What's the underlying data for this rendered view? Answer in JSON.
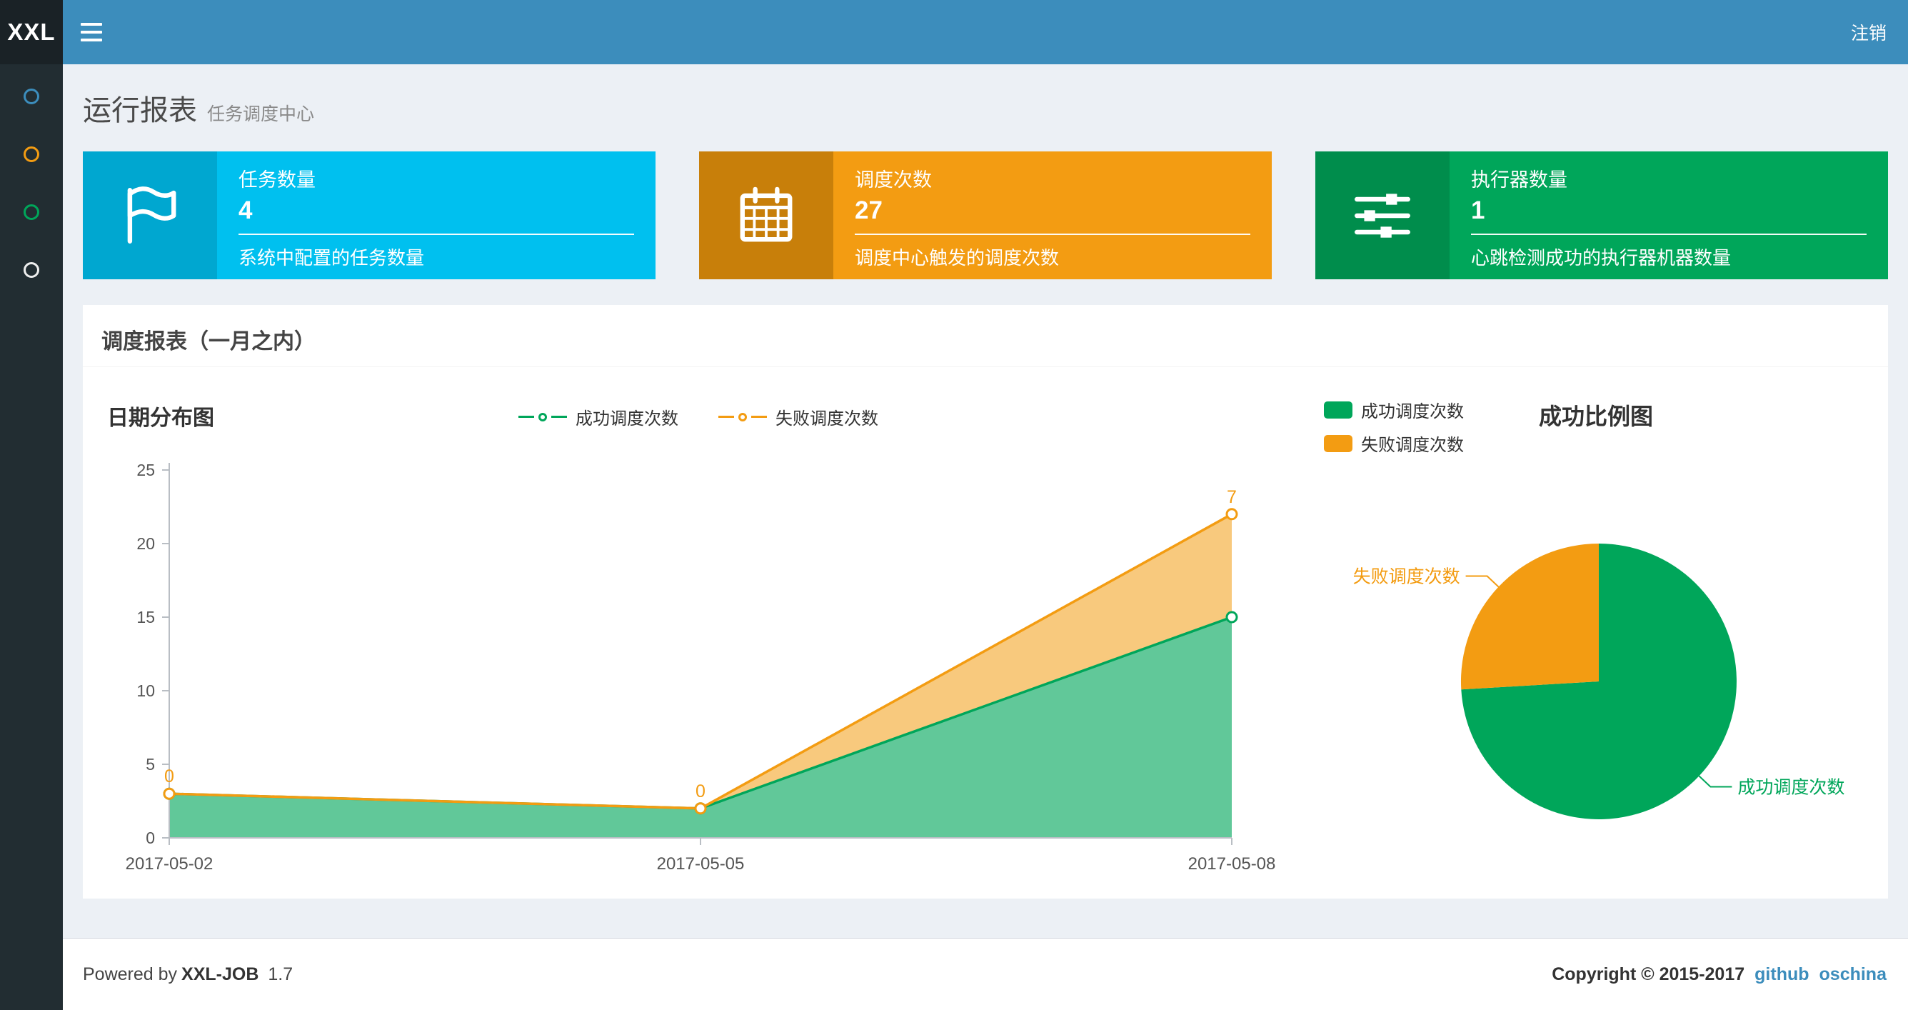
{
  "navbar": {
    "logo": "XXL",
    "logout": "注销"
  },
  "sidebar": {
    "items": [
      {
        "color": "#3c8dbc"
      },
      {
        "color": "#f39c12"
      },
      {
        "color": "#00a65a"
      },
      {
        "color": "#eeeeee"
      }
    ]
  },
  "header": {
    "title": "运行报表",
    "subtitle": "任务调度中心"
  },
  "info_boxes": [
    {
      "title": "任务数量",
      "value": "4",
      "desc": "系统中配置的任务数量",
      "bg": "#00c0ef",
      "icon_bg": "#00a7d0",
      "icon": "flag-icon"
    },
    {
      "title": "调度次数",
      "value": "27",
      "desc": "调度中心触发的调度次数",
      "bg": "#f39c12",
      "icon_bg": "#c87f0a",
      "icon": "calendar-icon"
    },
    {
      "title": "执行器数量",
      "value": "1",
      "desc": "心跳检测成功的执行器机器数量",
      "bg": "#00a65a",
      "icon_bg": "#008d4c",
      "icon": "sliders-icon"
    }
  ],
  "panel": {
    "title": "调度报表（一月之内）"
  },
  "chart_data": [
    {
      "type": "area",
      "title": "日期分布图",
      "stacked": true,
      "categories": [
        "2017-05-02",
        "2017-05-05",
        "2017-05-08"
      ],
      "series": [
        {
          "name": "成功调度次数",
          "color": "#00a65a",
          "values": [
            3,
            2,
            15
          ]
        },
        {
          "name": "失败调度次数",
          "color": "#f39c12",
          "values": [
            0,
            0,
            7
          ],
          "point_labels": [
            "0",
            "0",
            "7"
          ]
        }
      ],
      "ylim": [
        0,
        25
      ],
      "yticks": [
        0,
        5,
        10,
        15,
        20,
        25
      ],
      "legend_position": "top-center",
      "grid": false
    },
    {
      "type": "pie",
      "title": "成功比例图",
      "slices": [
        {
          "name": "成功调度次数",
          "value": 20,
          "color": "#00a65a"
        },
        {
          "name": "失败调度次数",
          "value": 7,
          "color": "#f39c12"
        }
      ],
      "legend_position": "top-left"
    }
  ],
  "footer": {
    "powered_prefix": "Powered by",
    "product": "XXL-JOB",
    "version": "1.7",
    "copyright": "Copyright © 2015-2017",
    "links": [
      "github",
      "oschina"
    ]
  }
}
